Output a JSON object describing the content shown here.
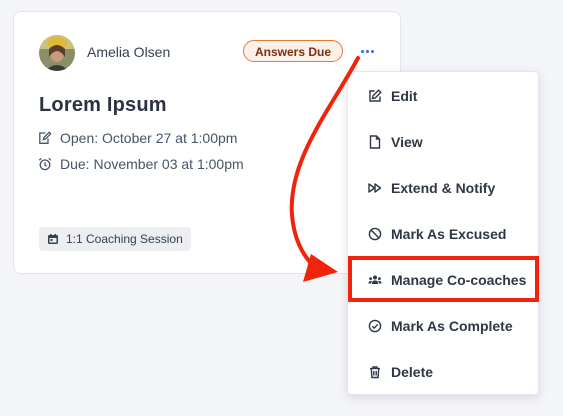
{
  "card": {
    "user": {
      "name": "Amelia Olsen"
    },
    "status_badge": "Answers Due",
    "title": "Lorem Ipsum",
    "open_text": "Open: October 27 at 1:00pm",
    "due_text": "Due: November 03 at 1:00pm",
    "session_tag": "1:1 Coaching Session"
  },
  "menu": {
    "items": [
      {
        "label": "Edit",
        "icon": "edit-icon"
      },
      {
        "label": "View",
        "icon": "file-icon"
      },
      {
        "label": "Extend & Notify",
        "icon": "fast-forward-icon"
      },
      {
        "label": "Mark As Excused",
        "icon": "prohibited-icon"
      },
      {
        "label": "Manage Co-coaches",
        "icon": "users-icon"
      },
      {
        "label": "Mark As Complete",
        "icon": "check-circle-icon"
      },
      {
        "label": "Delete",
        "icon": "trash-icon"
      }
    ],
    "highlighted_item": "Manage Co-coaches"
  },
  "colors": {
    "badge_border": "#e8773a",
    "badge_text": "#7a2f10",
    "accent_blue": "#2d6fe0",
    "annotation_red": "#f0240c",
    "page_background": "#f4f5f9"
  }
}
